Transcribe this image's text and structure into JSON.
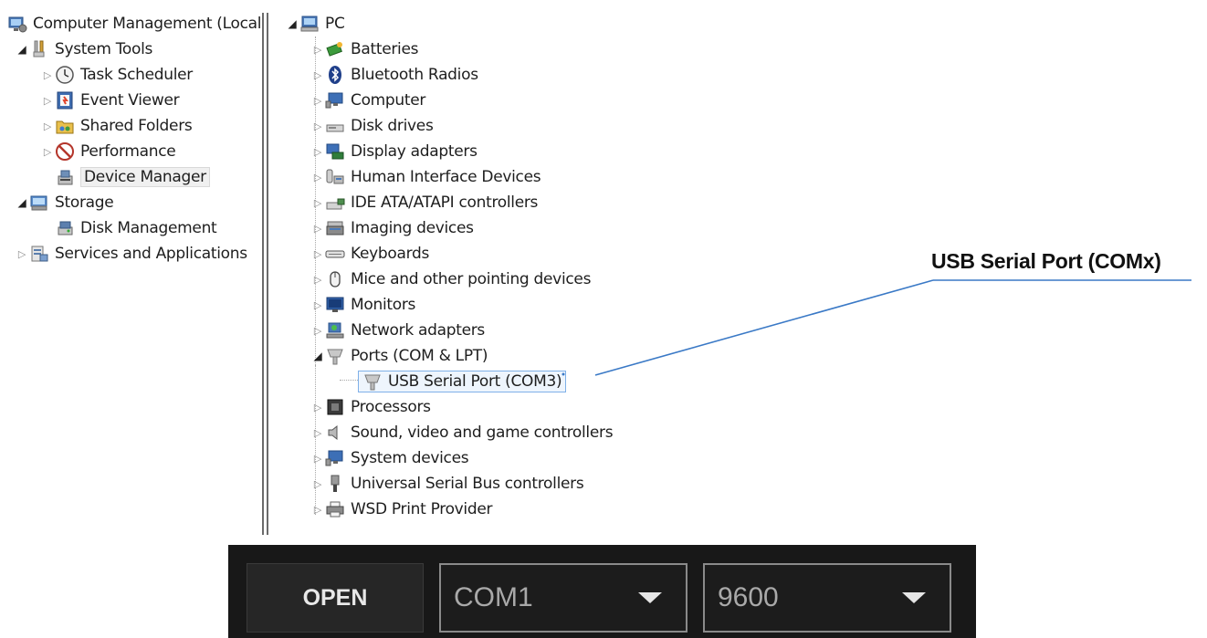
{
  "console_tree": {
    "root": "Computer Management (Local",
    "system_tools": "System Tools",
    "task_scheduler": "Task Scheduler",
    "event_viewer": "Event Viewer",
    "shared_folders": "Shared Folders",
    "performance": "Performance",
    "device_manager": "Device Manager",
    "storage": "Storage",
    "disk_management": "Disk Management",
    "services": "Services and Applications"
  },
  "device_tree": {
    "root": "PC",
    "categories": [
      "Batteries",
      "Bluetooth Radios",
      "Computer",
      "Disk drives",
      "Display adapters",
      "Human Interface Devices",
      "IDE ATA/ATAPI controllers",
      "Imaging devices",
      "Keyboards",
      "Mice and other pointing devices",
      "Monitors",
      "Network adapters",
      "Ports (COM & LPT)",
      "Processors",
      "Sound, video and game controllers",
      "System devices",
      "Universal Serial Bus controllers",
      "WSD Print Provider"
    ],
    "port_child": "USB Serial Port (COM3)"
  },
  "annotation": {
    "label": "USB Serial Port (COMx)"
  },
  "toolbar": {
    "open_label": "OPEN",
    "port_value": "COM1",
    "baud_value": "9600"
  },
  "colors": {
    "toolbar_bg": "#181818",
    "callout_line": "#3a79c6",
    "selection_border": "#7fb0e8"
  }
}
